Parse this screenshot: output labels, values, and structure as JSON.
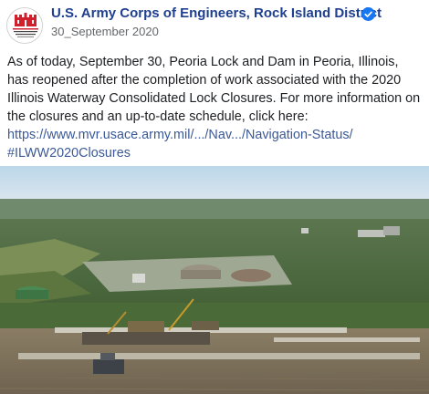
{
  "post": {
    "author": "U.S. Army Corps of Engineers, Rock Island District",
    "date": "30_September 2020",
    "body": "As of today, September 30, Peoria Lock and Dam in Peoria, Illinois, has reopened after the completion of work associated with the 2020 Illinois Waterway Consolidated Lock Closures. For more information on the closures and an up-to-date schedule, click here:",
    "link": "https://www.mvr.usace.army.mil/.../Nav.../Navigation-Status/",
    "hashtag": "#ILWW2020Closures",
    "avatar_text": "US Army Corps of Engineers",
    "icons": {
      "verified": "verified-badge-icon"
    },
    "colors": {
      "author": "#1f3f8f",
      "link": "#3b5998",
      "verified": "#1877f2",
      "logo_red": "#d0202e"
    }
  }
}
